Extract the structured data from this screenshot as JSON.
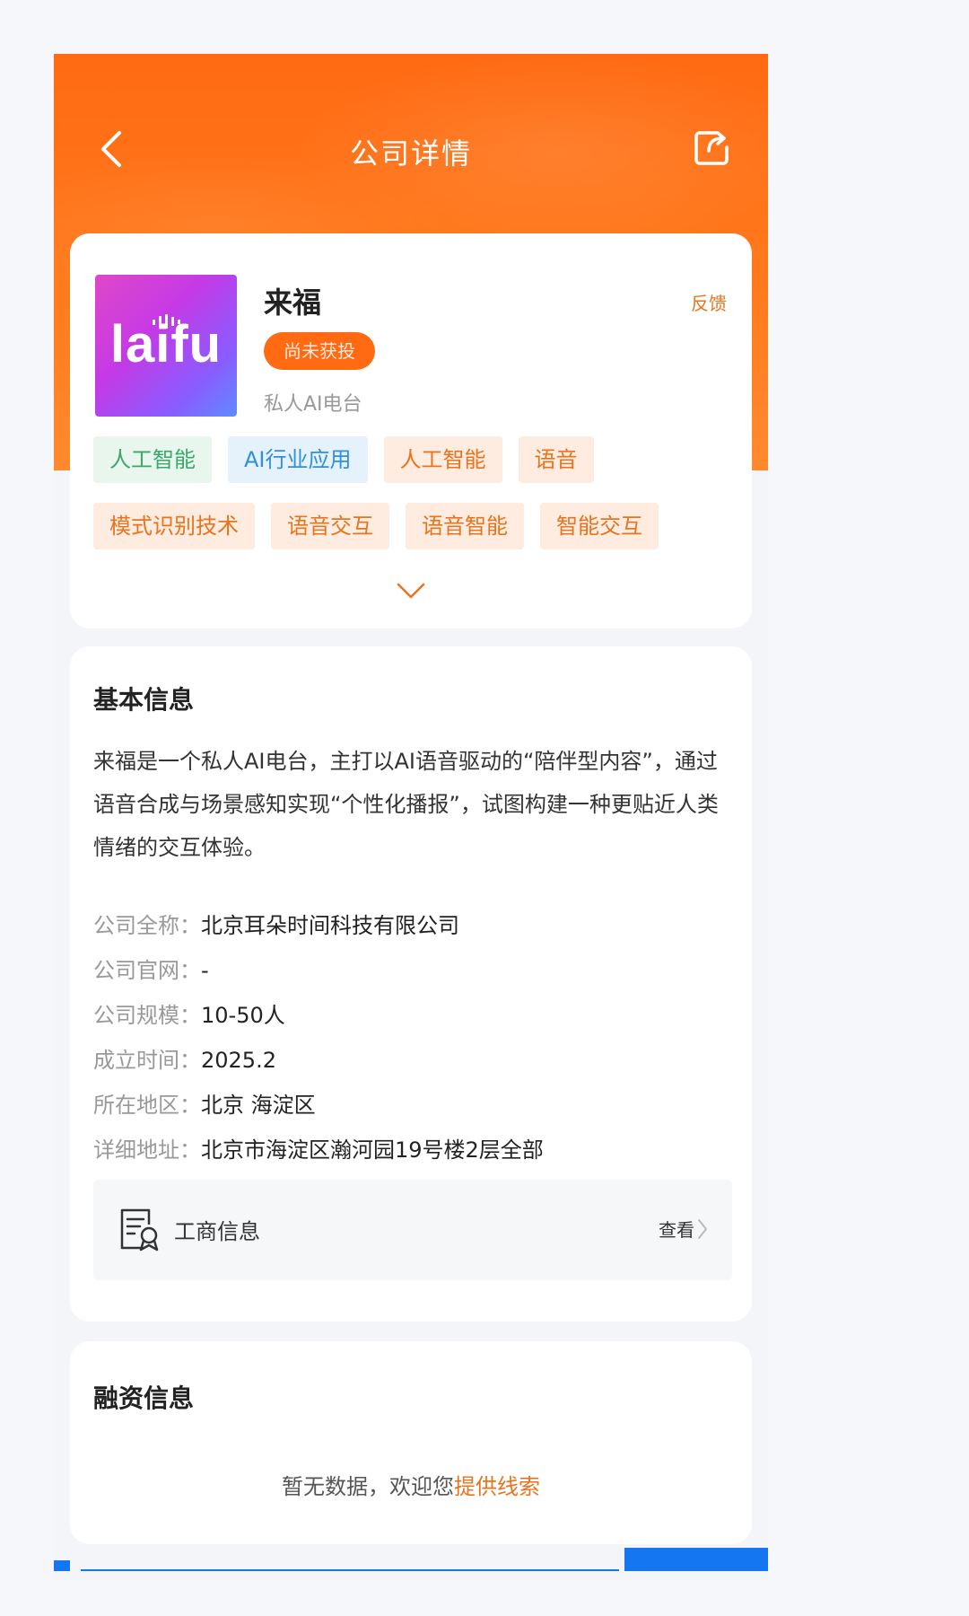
{
  "navbar": {
    "title": "公司详情",
    "back_icon": "chevron-left-icon",
    "share_icon": "share-icon"
  },
  "company": {
    "logo_text": "laifu",
    "name": "来福",
    "status": "尚未获投",
    "slogan": "私人AI电台",
    "feedback": "反馈",
    "tags": [
      {
        "label": "人工智能",
        "style": "green"
      },
      {
        "label": "AI行业应用",
        "style": "blue"
      },
      {
        "label": "人工智能",
        "style": "orange"
      },
      {
        "label": "语音",
        "style": "orange"
      },
      {
        "label": "模式识别技术",
        "style": "orange"
      },
      {
        "label": "语音交互",
        "style": "orange"
      },
      {
        "label": "语音智能",
        "style": "orange"
      },
      {
        "label": "智能交互",
        "style": "orange"
      }
    ]
  },
  "basic_info": {
    "title": "基本信息",
    "description": "来福是一个私人AI电台，主打以AI语音驱动的“陪伴型内容”，通过语音合成与场景感知实现“个性化播报”，试图构建一种更贴近人类情绪的交互体验。",
    "rows": [
      {
        "label": "公司全称：",
        "value": "北京耳朵时间科技有限公司"
      },
      {
        "label": "公司官网：",
        "value": "-"
      },
      {
        "label": "公司规模：",
        "value": "10-50人"
      },
      {
        "label": "成立时间：",
        "value": "2025.2"
      },
      {
        "label": "所在地区：",
        "value": "北京 海淀区"
      },
      {
        "label": "详细地址：",
        "value": "北京市海淀区瀚河园19号楼2层全部"
      }
    ],
    "business": {
      "label": "工商信息",
      "view": "查看"
    }
  },
  "funding": {
    "title": "融资信息",
    "empty_text": "暂无数据，欢迎您",
    "empty_link": "提供线索"
  },
  "colors": {
    "brand_orange": "#ff6a12",
    "link_orange": "#e8741f",
    "tag_green": "#3aa76d",
    "tag_blue": "#2f8fe0",
    "bottom_blue": "#1476f0"
  }
}
